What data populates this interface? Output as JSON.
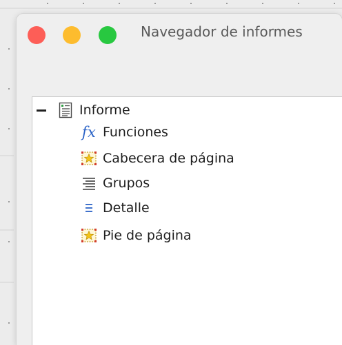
{
  "window": {
    "title": "Navegador de informes"
  },
  "tree": {
    "root": {
      "label": "Informe",
      "expanded": true
    },
    "children": [
      {
        "label": "Funciones",
        "icon": "functions-icon"
      },
      {
        "label": "Cabecera de página",
        "icon": "page-header-icon"
      },
      {
        "label": "Grupos",
        "icon": "groups-icon"
      },
      {
        "label": "Detalle",
        "icon": "detail-icon"
      },
      {
        "label": "Pie de página",
        "icon": "page-footer-icon"
      }
    ]
  },
  "colors": {
    "close": "#fd5e57",
    "minimize": "#fdbc2e",
    "maximize": "#28c840",
    "function_accent": "#2b63c7",
    "section_star": "#f3c31a",
    "section_border": "#d33a2c"
  }
}
